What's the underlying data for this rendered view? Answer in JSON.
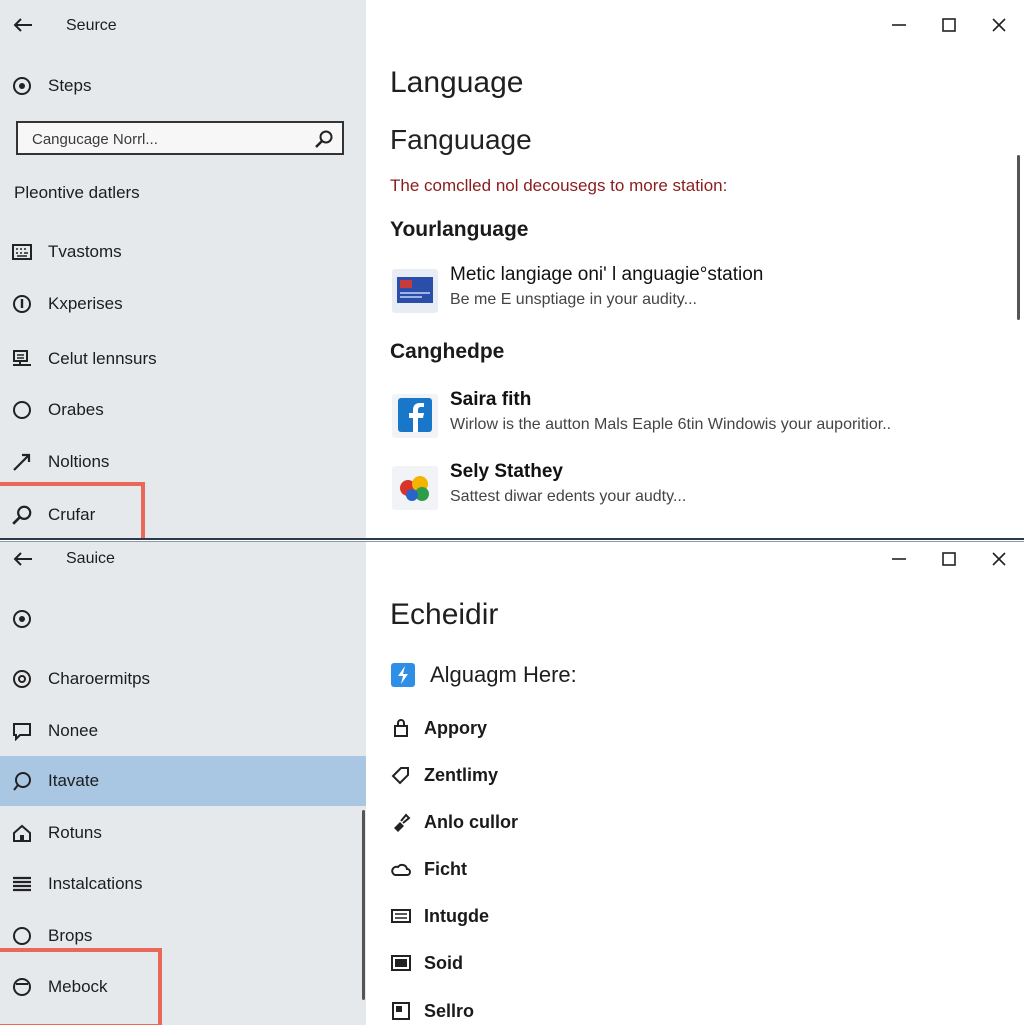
{
  "colors": {
    "sidebar_bg": "#e6e9ec",
    "selected_bg": "#a9c6e3",
    "highlight": "#e9685a",
    "notice": "#8a1c1c"
  },
  "window1": {
    "title": "Seurce",
    "sidebar": {
      "top_item": "Steps",
      "search_placeholder": "Cangucage Norrl...",
      "section_label": "Pleontive datlers",
      "items": [
        {
          "label": "Tvastoms",
          "icon": "keyboard-icon"
        },
        {
          "label": "Kxperises",
          "icon": "info-circle-icon"
        },
        {
          "label": "Celut lennsurs",
          "icon": "display-icon"
        },
        {
          "label": "Orabes",
          "icon": "circle-icon"
        },
        {
          "label": "Noltions",
          "icon": "arrow-diagonal-icon"
        },
        {
          "label": "Crufar",
          "icon": "search-icon"
        }
      ]
    },
    "main": {
      "title": "Language",
      "subtitle": "Fanguuage",
      "notice": "The comclled nol decousegs to more station:",
      "section1": "Yourlanguage",
      "items1": [
        {
          "title": "Metic langiage oni' l anguagie°station",
          "desc": "Be me E unsptiage in your audity..."
        }
      ],
      "section2": "Canghedpe",
      "items2": [
        {
          "title": "Saira fith",
          "desc": "Wirlow is the autton Mals Eaple 6tin Windowis your auporitior.."
        },
        {
          "title": "Sely Stathey",
          "desc": "Sattest diwar edents your audty..."
        }
      ]
    }
  },
  "window2": {
    "title": "Sauice",
    "sidebar": {
      "items": [
        {
          "label": "",
          "icon": "settings-icon"
        },
        {
          "label": "Charoermitps",
          "icon": "at-icon"
        },
        {
          "label": "Nonee",
          "icon": "chat-icon"
        },
        {
          "label": "Itavate",
          "icon": "speech-bubble-icon",
          "selected": true
        },
        {
          "label": "Rotuns",
          "icon": "home-icon"
        },
        {
          "label": "Instalcations",
          "icon": "list-icon"
        },
        {
          "label": "Brops",
          "icon": "circle-icon"
        },
        {
          "label": "Mebock",
          "icon": "globe-icon"
        }
      ]
    },
    "main": {
      "title": "Echeidir",
      "subheading": "Alguagm Here:",
      "items": [
        {
          "label": "Appory",
          "icon": "lock-icon"
        },
        {
          "label": "Zentlimy",
          "icon": "tag-icon"
        },
        {
          "label": "Anlo cullor",
          "icon": "paint-icon"
        },
        {
          "label": "Ficht",
          "icon": "cloud-icon"
        },
        {
          "label": "Intugde",
          "icon": "keyboard-icon"
        },
        {
          "label": "Soid",
          "icon": "monitor-icon"
        },
        {
          "label": "Sellro",
          "icon": "window-icon"
        }
      ]
    }
  }
}
